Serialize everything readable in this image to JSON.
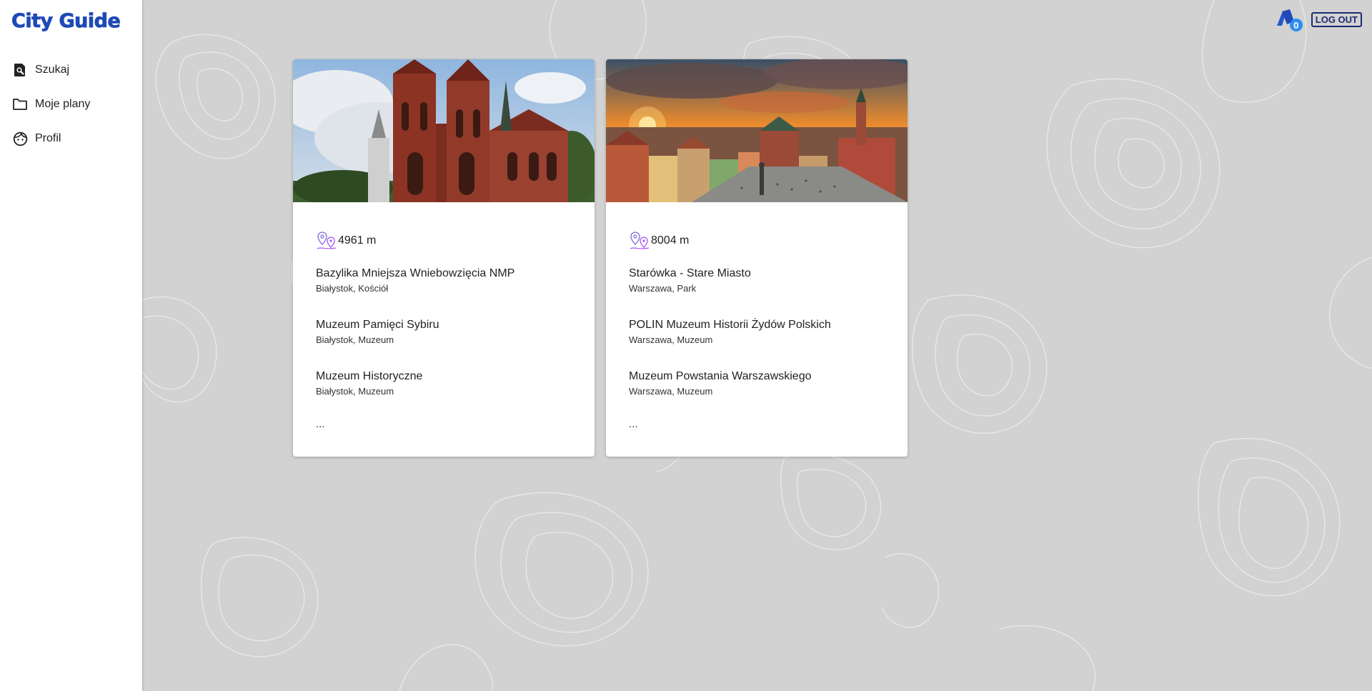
{
  "app": {
    "title": "City Guide"
  },
  "sidebar": {
    "items": [
      {
        "label": "Szukaj",
        "icon": "search-document-icon"
      },
      {
        "label": "Moje plany",
        "icon": "folder-icon"
      },
      {
        "label": "Profil",
        "icon": "face-icon"
      }
    ]
  },
  "topbar": {
    "cart_count": "0",
    "logout_label": "LOG OUT"
  },
  "colors": {
    "brand": "#1f49b6",
    "badge": "#2f8ef0",
    "pin_accent": "#a855f7"
  },
  "cards": [
    {
      "distance": "4961 m",
      "image": "cathedral-photo",
      "places": [
        {
          "name": "Bazylika Mniejsza Wniebowzięcia NMP",
          "meta": "Białystok, Kościół"
        },
        {
          "name": "Muzeum Pamięci Sybiru",
          "meta": "Białystok, Muzeum"
        },
        {
          "name": "Muzeum Historyczne",
          "meta": "Białystok, Muzeum"
        }
      ],
      "more": "..."
    },
    {
      "distance": "8004 m",
      "image": "old-town-sunset-photo",
      "places": [
        {
          "name": "Starówka - Stare Miasto",
          "meta": "Warszawa, Park"
        },
        {
          "name": "POLIN Muzeum Historii Żydów Polskich",
          "meta": "Warszawa, Muzeum"
        },
        {
          "name": "Muzeum Powstania Warszawskiego",
          "meta": "Warszawa, Muzeum"
        }
      ],
      "more": "..."
    }
  ]
}
